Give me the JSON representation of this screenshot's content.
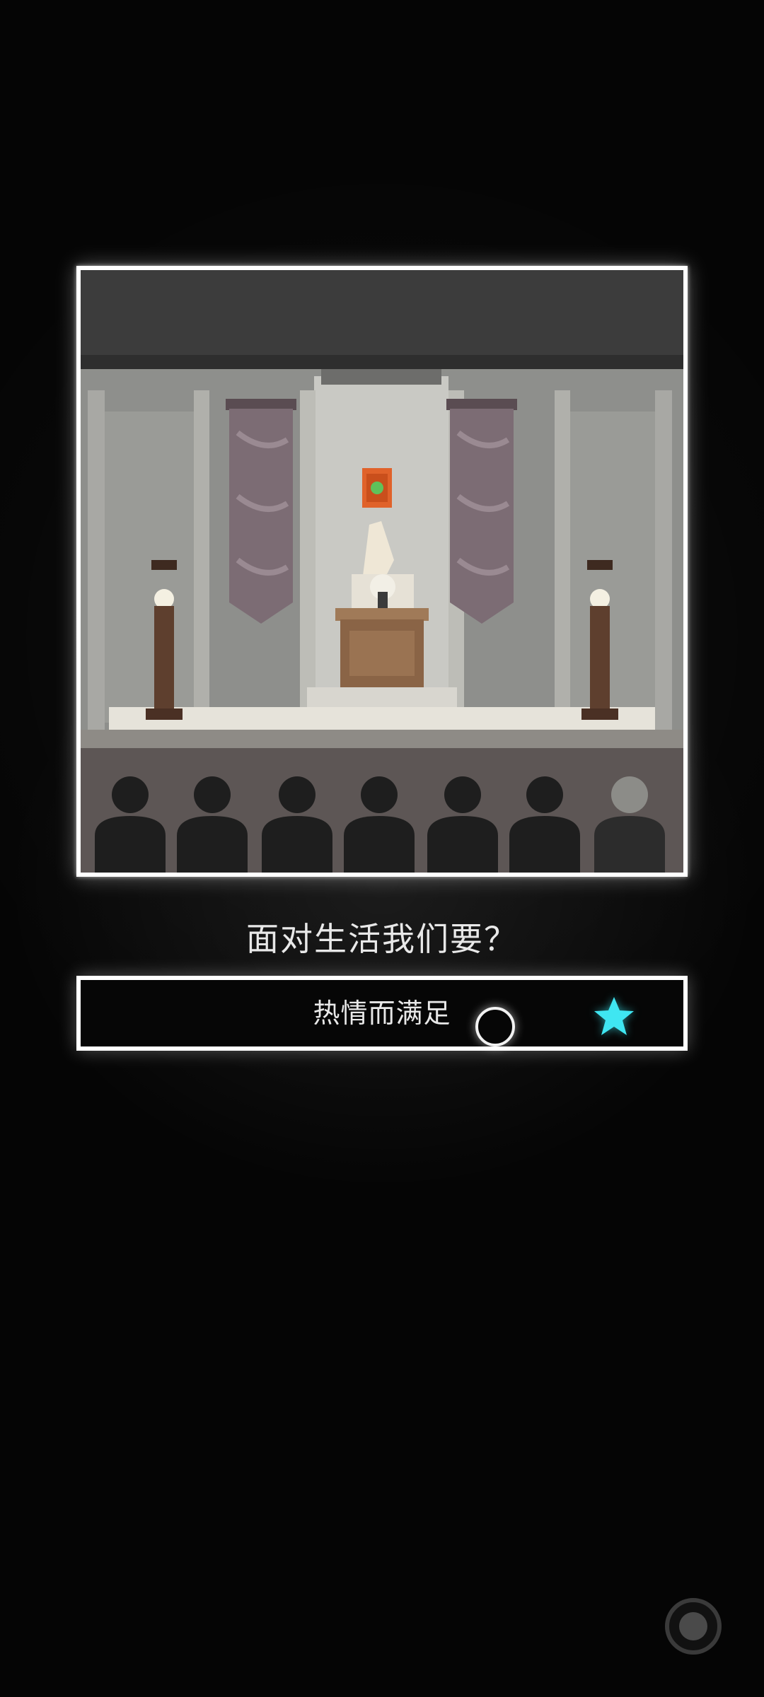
{
  "scene": {
    "image_icon": "lecture-hall-scene-icon"
  },
  "question": {
    "text": "面对生活我们要？"
  },
  "answer": {
    "text": "热情而满足",
    "cursor_icon": "circle-cursor-icon",
    "mark_icon": "star-icon",
    "mark_color": "#3fe6f2"
  },
  "menu_button": {
    "icon": "record-circle-icon"
  }
}
